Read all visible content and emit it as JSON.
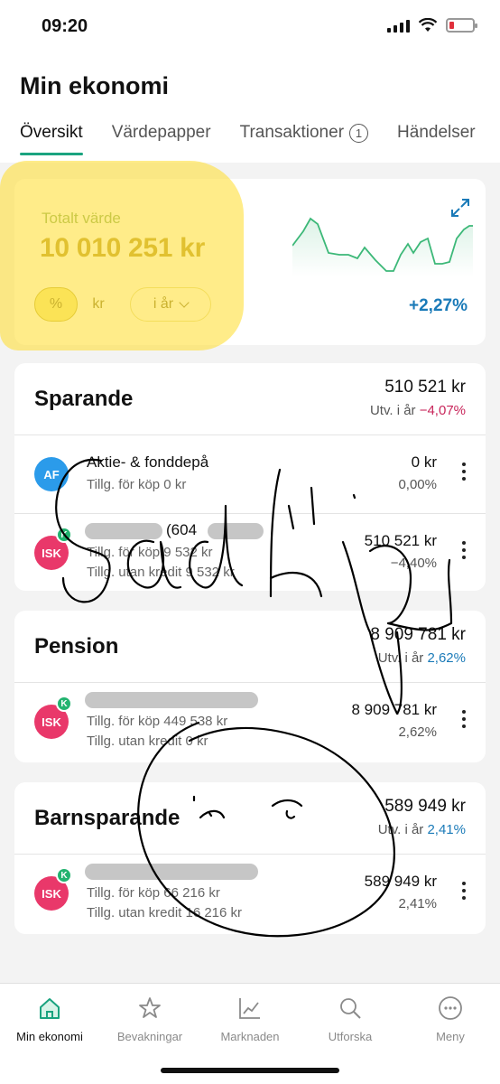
{
  "status": {
    "time": "09:20"
  },
  "header": {
    "title": "Min ekonomi",
    "tabs": [
      {
        "label": "Översikt",
        "active": true
      },
      {
        "label": "Värdepapper"
      },
      {
        "label": "Transaktioner",
        "badge": "1"
      },
      {
        "label": "Händelser"
      }
    ]
  },
  "overview": {
    "label": "Totalt värde",
    "value": "10 010 251 kr",
    "toggle_pct": "%",
    "toggle_kr": "kr",
    "range": "i år",
    "change": "+2,27%"
  },
  "sparande": {
    "title": "Sparande",
    "amount": "510 521 kr",
    "sub_label": "Utv. i år",
    "sub_value": "−4,07%",
    "accounts": [
      {
        "avatar": "AF",
        "name": "Aktie- & fonddepå",
        "line1": "Tillg. för köp 0 kr",
        "amount": "0 kr",
        "pct": "0,00%"
      },
      {
        "avatar": "ISK",
        "name_visible": "(604",
        "line1": "Tillg. för köp 9 532 kr",
        "line2": "Tillg. utan kredit 9 532 kr",
        "amount": "510 521 kr",
        "pct": "−4,40%"
      }
    ]
  },
  "pension": {
    "title": "Pension",
    "amount": "8 909 781 kr",
    "sub_label": "Utv. i år",
    "sub_value": "2,62%",
    "accounts": [
      {
        "avatar": "ISK",
        "line1": "Tillg. för köp 449 538 kr",
        "line2": "Tillg. utan kredit 0 kr",
        "amount": "8 909 781 kr",
        "pct": "2,62%"
      }
    ]
  },
  "barnsparande": {
    "title": "Barnsparande",
    "amount": "589 949 kr",
    "sub_label": "Utv. i år",
    "sub_value": "2,41%",
    "accounts": [
      {
        "avatar": "ISK",
        "line1": "Tillg. för köp 66 216 kr",
        "line2": "Tillg. utan kredit 16 216 kr",
        "amount": "589 949 kr",
        "pct": "2,41%"
      }
    ]
  },
  "badge_k": "K",
  "nav": [
    {
      "label": "Min ekonomi",
      "icon": "home-icon",
      "active": true
    },
    {
      "label": "Bevakningar",
      "icon": "star-icon"
    },
    {
      "label": "Marknaden",
      "icon": "chart-icon"
    },
    {
      "label": "Utforska",
      "icon": "search-icon"
    },
    {
      "label": "Meny",
      "icon": "more-icon"
    }
  ],
  "colors": {
    "accent": "#1aa37f",
    "negative": "#c8255a",
    "positive": "#1a7ab8",
    "highlight": "#ffdc28"
  }
}
